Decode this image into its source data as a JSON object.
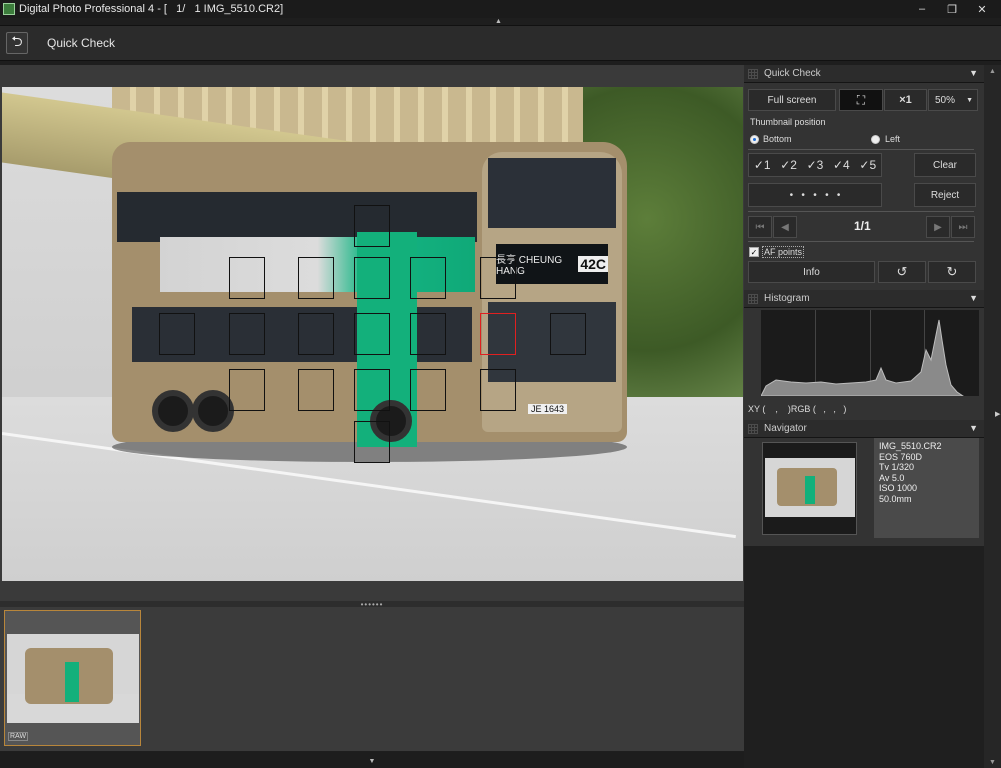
{
  "window": {
    "title": "Digital Photo Professional 4 - [   1/   1 IMG_5510.CR2]",
    "minimize": "–",
    "restore": "❐",
    "close": "✕"
  },
  "toolbar": {
    "back_icon": "⮌",
    "title": "Quick Check"
  },
  "photo": {
    "destination_label": "長亨 CHEUNG HANG",
    "route": "42C",
    "plate": "JE 1643"
  },
  "filmstrip": {
    "handle": "••••••",
    "thumb_tag": "RAW"
  },
  "quick_check_panel": {
    "header": "Quick Check",
    "full_screen": "Full screen",
    "fit_icon": "⛶",
    "zoom_x1": "×1",
    "zoom_pct": "50%",
    "zoom_caret": "▼",
    "thumbnail_position_label": "Thumbnail position",
    "bottom_label": "Bottom",
    "left_label": "Left",
    "ratings": [
      "✓1",
      "✓2",
      "✓3",
      "✓4",
      "✓5"
    ],
    "clear": "Clear",
    "dots": "•   •   •   •   •",
    "reject": "Reject",
    "page": "1/1",
    "first_icon": "⏮",
    "prev_icon": "◀",
    "next_icon": "▶",
    "last_icon": "⏭",
    "af_points_label": "AF points",
    "af_checked": "✓",
    "info": "Info",
    "rotate_left_icon": "↺",
    "rotate_right_icon": "↻"
  },
  "histogram_panel": {
    "header": "Histogram",
    "readout": "XY (    ,    )RGB (   ,   ,   )"
  },
  "navigator_panel": {
    "header": "Navigator",
    "info": {
      "filename": "IMG_5510.CR2",
      "camera": "EOS 760D",
      "tv": "Tv 1/320",
      "av": "Av 5.0",
      "iso": "ISO 1000",
      "focal": "50.0mm"
    }
  },
  "colors": {
    "accent_thumb_border": "#b8863b",
    "af_selected": "#e02020",
    "bus_green": "#13b07b"
  }
}
